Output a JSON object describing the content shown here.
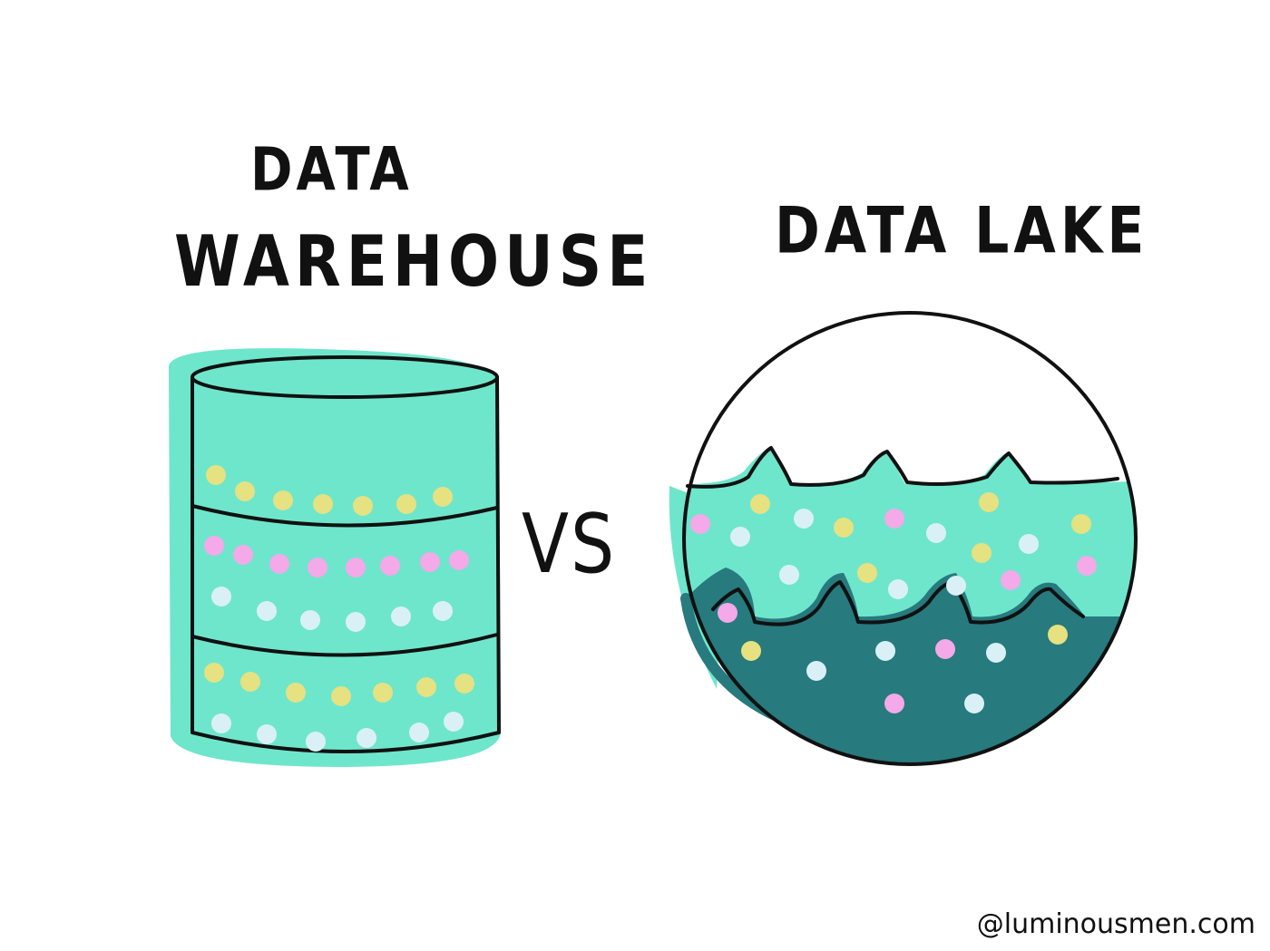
{
  "data_warehouse": {
    "title_line1": "DATA",
    "title_line2": "WAREHOUSE"
  },
  "data_lake": {
    "title": "DATA LAKE"
  },
  "separator": "VS",
  "credit": "@luminousmen.com",
  "colors": {
    "mint": "#6ee6cc",
    "deep_teal": "#277a7d",
    "outline": "#111111",
    "dot_yellow": "#e6e181",
    "dot_pink": "#f4a9e8",
    "dot_light_blue": "#d9f1f6"
  }
}
